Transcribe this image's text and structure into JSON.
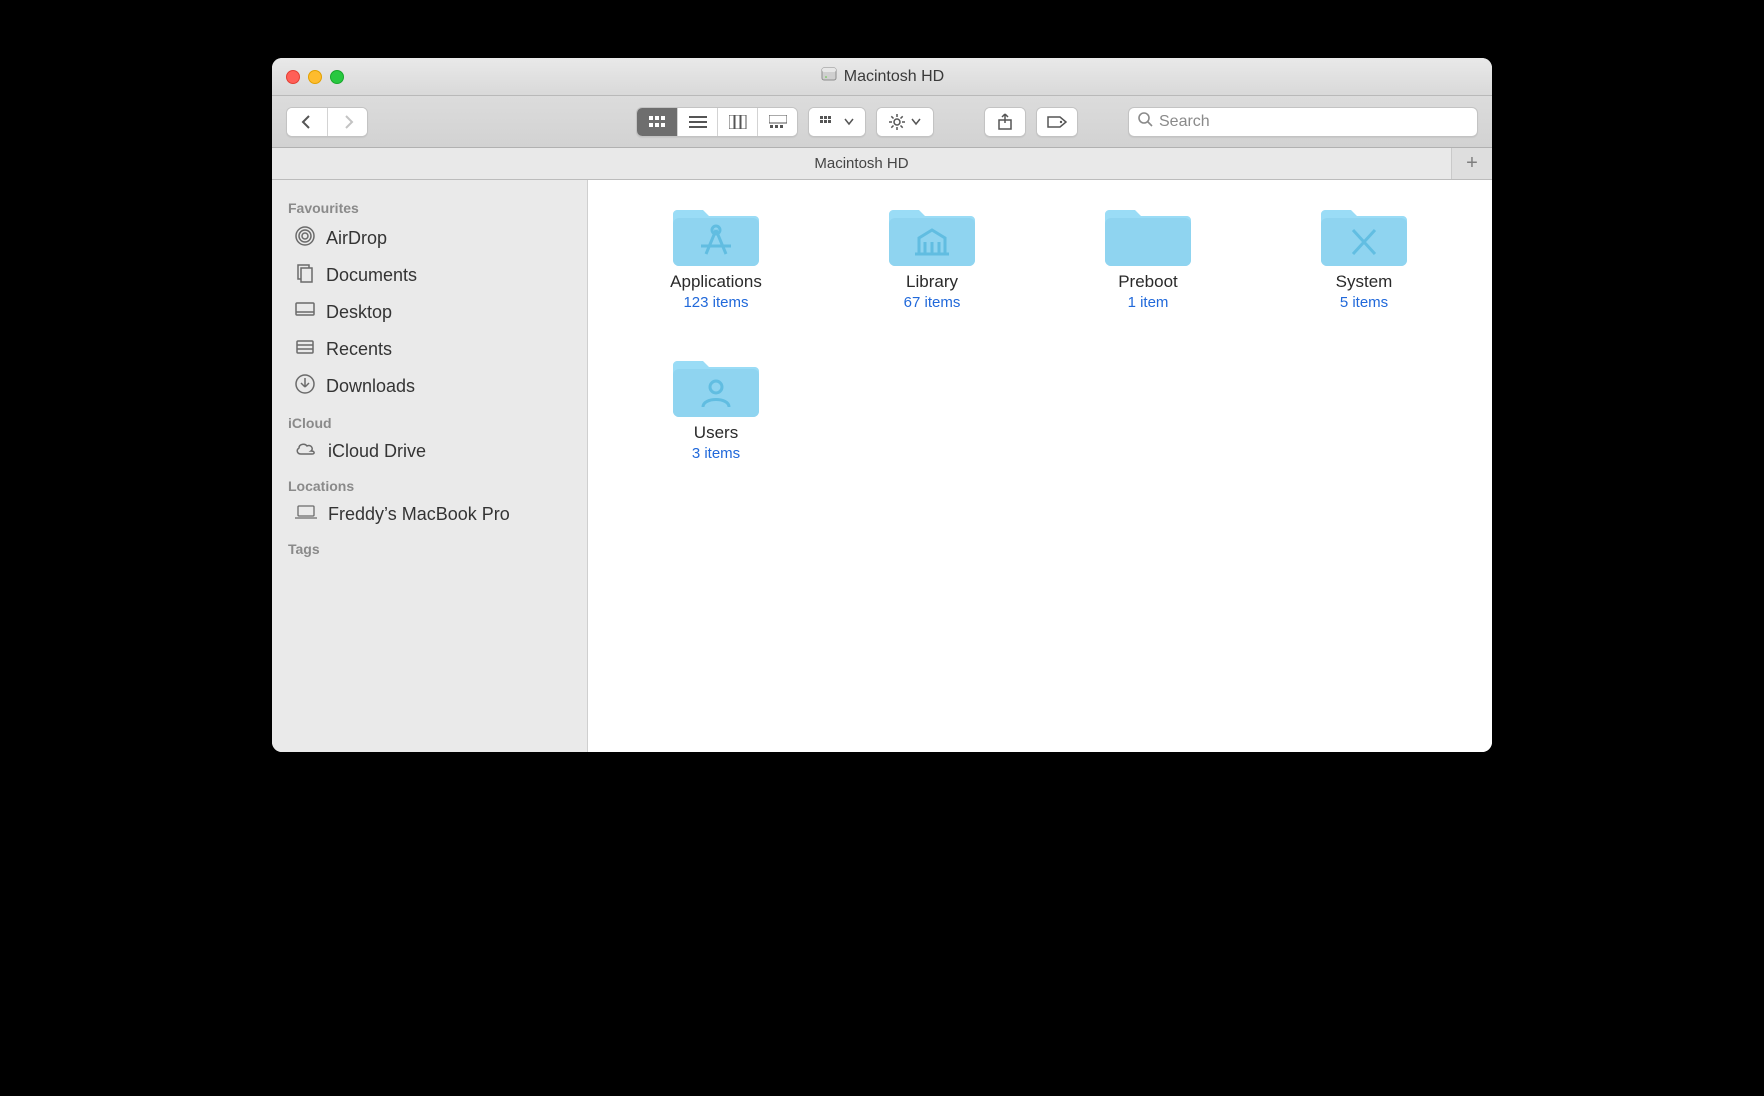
{
  "window": {
    "title": "Macintosh HD"
  },
  "toolbar": {
    "search_placeholder": "Search"
  },
  "tabbar": {
    "tab_label": "Macintosh HD"
  },
  "sidebar": {
    "sections": [
      {
        "header": "Favourites",
        "items": [
          {
            "label": "AirDrop",
            "icon": "airdrop"
          },
          {
            "label": "Documents",
            "icon": "documents"
          },
          {
            "label": "Desktop",
            "icon": "desktop"
          },
          {
            "label": "Recents",
            "icon": "recents"
          },
          {
            "label": "Downloads",
            "icon": "downloads"
          }
        ]
      },
      {
        "header": "iCloud",
        "items": [
          {
            "label": "iCloud Drive",
            "icon": "cloud"
          }
        ]
      },
      {
        "header": "Locations",
        "items": [
          {
            "label": "Freddy’s MacBook Pro",
            "icon": "laptop"
          }
        ]
      },
      {
        "header": "Tags",
        "items": []
      }
    ]
  },
  "content": {
    "folders": [
      {
        "name": "Applications",
        "meta": "123 items",
        "glyph": "apps"
      },
      {
        "name": "Library",
        "meta": "67 items",
        "glyph": "library"
      },
      {
        "name": "Preboot",
        "meta": "1 item",
        "glyph": "none"
      },
      {
        "name": "System",
        "meta": "5 items",
        "glyph": "system"
      },
      {
        "name": "Users",
        "meta": "3 items",
        "glyph": "users"
      }
    ]
  }
}
